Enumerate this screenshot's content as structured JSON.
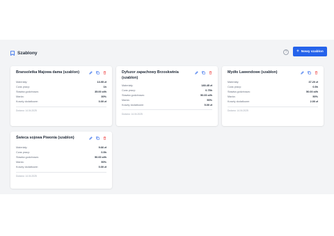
{
  "header": {
    "title": "Szablony",
    "new_button_label": "Nowy szablon",
    "new_button_icon": "plus-icon",
    "help_icon": "help-circle-icon",
    "page_icon": "bookmark-icon"
  },
  "colors": {
    "accent": "#2563eb",
    "danger": "#ef4444",
    "panel_bg": "#f3f4f6"
  },
  "cards": [
    {
      "title": "Bransoletka Majowa dama (szablon)",
      "rows": [
        {
          "label": "Materiały:",
          "value": "13.95 zł"
        },
        {
          "label": "Czas pracy:",
          "value": "1h"
        },
        {
          "label": "Stawka godzinowa:",
          "value": "35.00 zł/h"
        },
        {
          "label": "Marża:",
          "value": "30%"
        },
        {
          "label": "Koszty dodatkowe:",
          "value": "0.00 zł"
        }
      ],
      "added": "Dodano: 14.04.2025"
    },
    {
      "title": "Dyfuzor zapachowy Brzoskwinia (szablon)",
      "rows": [
        {
          "label": "Materiały:",
          "value": "180.45 zł"
        },
        {
          "label": "Czas pracy:",
          "value": "0.75h"
        },
        {
          "label": "Stawka godzinowa:",
          "value": "50.00 zł/h"
        },
        {
          "label": "Marża:",
          "value": "50%"
        },
        {
          "label": "Koszty dodatkowe:",
          "value": "5.00 zł"
        }
      ],
      "added": "Dodano: 14.04.2025"
    },
    {
      "title": "Mydło Lawendowe (szablon)",
      "rows": [
        {
          "label": "Materiały:",
          "value": "37.20 zł"
        },
        {
          "label": "Czas pracy:",
          "value": "0.5h"
        },
        {
          "label": "Stawka godzinowa:",
          "value": "50.00 zł/h"
        },
        {
          "label": "Marża:",
          "value": "50%"
        },
        {
          "label": "Koszty dodatkowe:",
          "value": "2.00 zł"
        }
      ],
      "added": "Dodano: 14.04.2025"
    },
    {
      "title": "Świeca sojowa Piwonia (szablon)",
      "rows": [
        {
          "label": "Materiały:",
          "value": "9.66 zł"
        },
        {
          "label": "Czas pracy:",
          "value": "0.5h"
        },
        {
          "label": "Stawka godzinowa:",
          "value": "50.00 zł/h"
        },
        {
          "label": "Marża:",
          "value": "50%"
        },
        {
          "label": "Koszty dodatkowe:",
          "value": "0.00 zł"
        }
      ],
      "added": "Dodano: 14.04.2025"
    }
  ]
}
